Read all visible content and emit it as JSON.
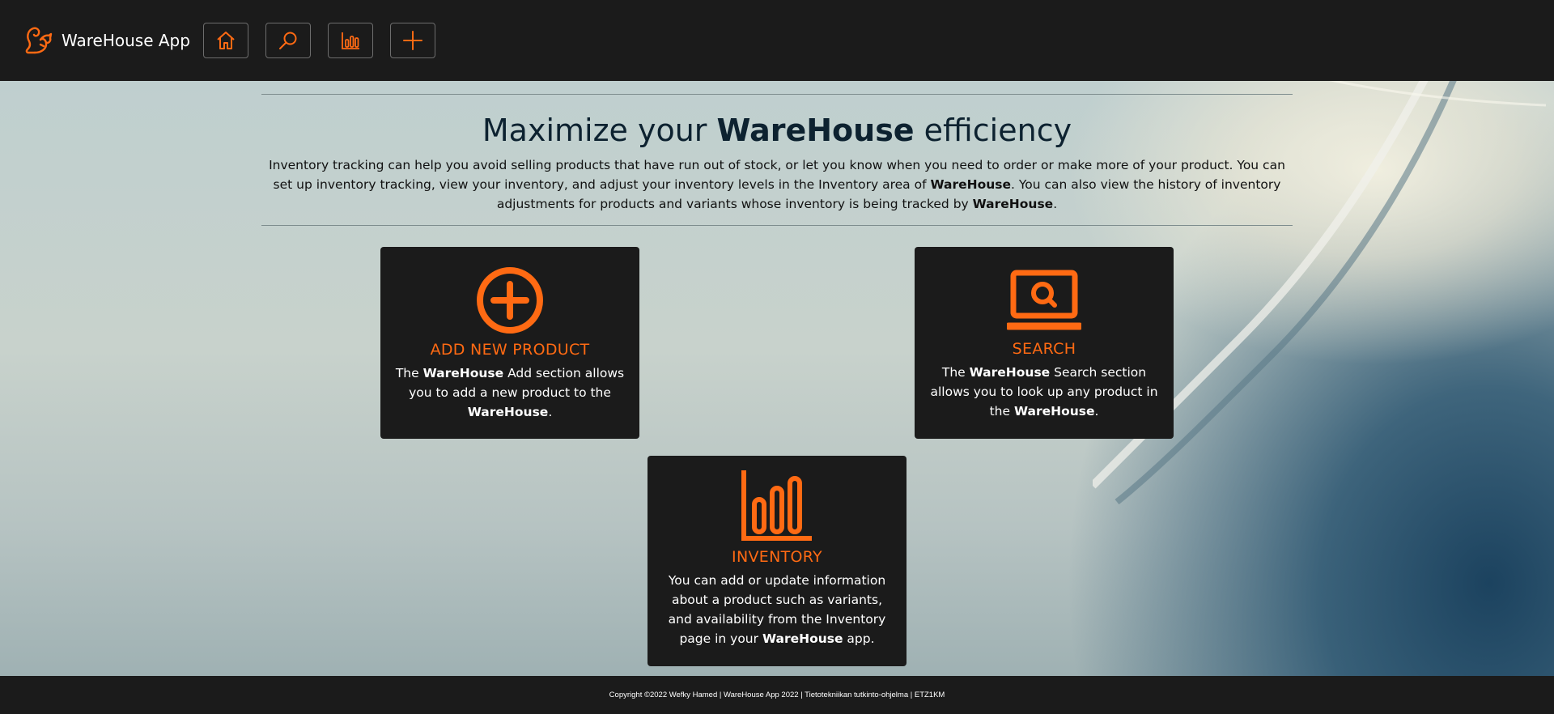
{
  "navbar": {
    "brand": "WareHouse App",
    "logo_icon": "squirrel-icon",
    "buttons": [
      {
        "name": "home-button",
        "icon": "home-icon"
      },
      {
        "name": "search-button",
        "icon": "search-icon"
      },
      {
        "name": "inventory-button",
        "icon": "bar-chart-icon"
      },
      {
        "name": "add-button",
        "icon": "plus-icon"
      }
    ]
  },
  "hero": {
    "title_pre": "Maximize your ",
    "title_brand": "WareHouse",
    "title_post": " efficiency",
    "text_1": "Inventory tracking can help you avoid selling products that have run out of stock, or let you know when you need to order or make more of your product. You can set up inventory tracking, view your inventory, and adjust your inventory levels in the Inventory area of ",
    "text_brand_1": "WareHouse",
    "text_2": ". You can also view the history of inventory adjustments for products and variants whose inventory is being tracked by ",
    "text_brand_2": "WareHouse",
    "text_3": "."
  },
  "cards": {
    "add": {
      "icon": "plus-circle-icon",
      "title": "ADD NEW PRODUCT",
      "text_pre": "The ",
      "brand": "WareHouse",
      "text_mid": " Add section allows you to add a new product to the ",
      "brand_2": "WareHouse",
      "text_post": "."
    },
    "search": {
      "icon": "laptop-search-icon",
      "title": "SEARCH",
      "text_pre": "The ",
      "brand": "WareHouse",
      "text_mid": " Search section allows you to look up any product in the ",
      "brand_2": "WareHouse",
      "text_post": "."
    },
    "inventory": {
      "icon": "bar-chart-icon",
      "title": "INVENTORY",
      "text_pre": "You can add or update information about a product such as variants, and availability from the Inventory page in your ",
      "brand": "WareHouse",
      "text_post": " app."
    }
  },
  "footer": {
    "text": "Copyright ©2022 Wefky Hamed | WareHouse App 2022 | Tietotekniikan tutkinto-ohjelma | ETZ1KM"
  },
  "colors": {
    "accent": "#ff6a13",
    "bar_bg": "#1b1b1b",
    "title_text": "#0d2230"
  }
}
